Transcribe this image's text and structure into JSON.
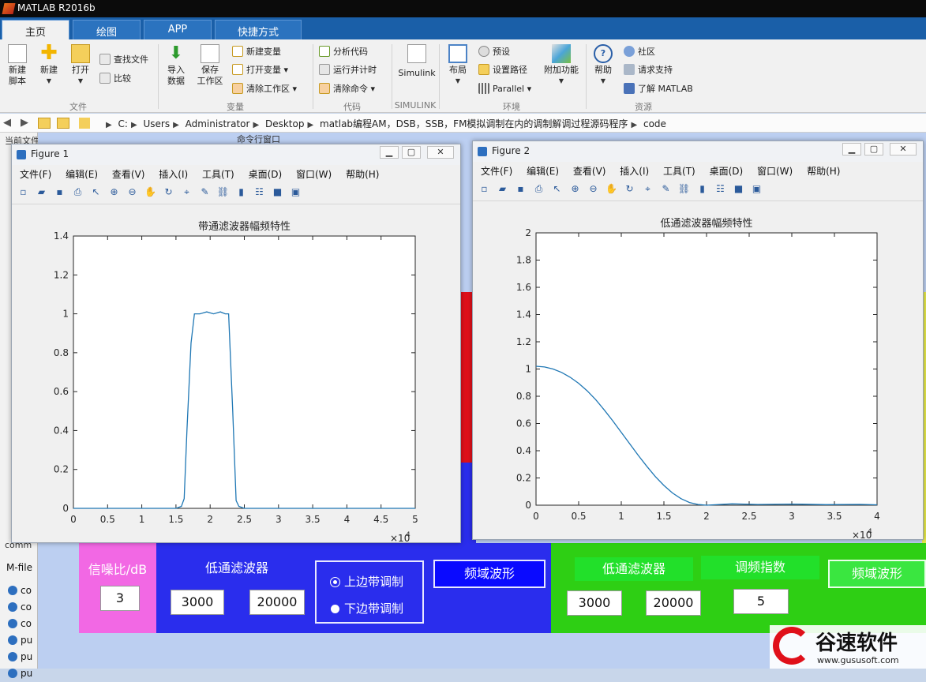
{
  "window": {
    "title": "MATLAB R2016b"
  },
  "tabs": [
    "主页",
    "绘图",
    "APP",
    "快捷方式"
  ],
  "ribbon": {
    "file": {
      "new_script": "新建\n脚本",
      "new": "新建",
      "open": "打开",
      "find_files": "查找文件",
      "compare": "比较",
      "group": "文件"
    },
    "variable": {
      "import": "导入\n数据",
      "save": "保存\n工作区",
      "new_var": "新建变量",
      "open_var": "打开变量",
      "clear_ws": "清除工作区",
      "group": "变量"
    },
    "code": {
      "analyze": "分析代码",
      "run_time": "运行并计时",
      "clear_cmd": "清除命令",
      "group": "代码"
    },
    "simulink": {
      "label": "Simulink",
      "group": "SIMULINK"
    },
    "env": {
      "layout": "布局",
      "prefs": "预设",
      "set_path": "设置路径",
      "parallel": "Parallel",
      "addons": "附加功能",
      "group": "环境"
    },
    "resources": {
      "help": "帮助",
      "community": "社区",
      "support": "请求支持",
      "learn": "了解 MATLAB",
      "group": "资源"
    }
  },
  "address": {
    "path": [
      "C:",
      "Users",
      "Administrator",
      "Desktop",
      "matlab编程AM，DSB，SSB，FM模拟调制在内的调制解调过程源码程序",
      "code"
    ]
  },
  "left_panel": {
    "current_folder": "当前文件夹",
    "cmd_window": "命令行窗口",
    "comm": "comm",
    "mfile": "M-file",
    "files": [
      "co",
      "co",
      "co",
      "pu",
      "pu",
      "pu"
    ]
  },
  "figure1": {
    "title": "Figure 1",
    "menu": [
      "文件(F)",
      "编辑(E)",
      "查看(V)",
      "插入(I)",
      "工具(T)",
      "桌面(D)",
      "窗口(W)",
      "帮助(H)"
    ]
  },
  "figure2": {
    "title": "Figure 2",
    "menu": [
      "文件(F)",
      "编辑(E)",
      "查看(V)",
      "插入(I)",
      "工具(T)",
      "桌面(D)",
      "窗口(W)",
      "帮助(H)"
    ]
  },
  "chart_data": [
    {
      "type": "line",
      "title": "带通滤波器幅频特性",
      "xlabel": "",
      "ylabel": "",
      "x_exponent": "×10",
      "x_exponent_power": "4",
      "xlim": [
        0,
        5
      ],
      "ylim": [
        0,
        1.4
      ],
      "xticks": [
        "0",
        "0.5",
        "1",
        "1.5",
        "2",
        "2.5",
        "3",
        "3.5",
        "4",
        "4.5",
        "5"
      ],
      "yticks": [
        "0",
        "0.2",
        "0.4",
        "0.6",
        "0.8",
        "1",
        "1.2",
        "1.4"
      ],
      "series": [
        {
          "color": "#1f77b4",
          "x": [
            0,
            1.5,
            1.58,
            1.62,
            1.66,
            1.72,
            1.77,
            1.85,
            1.95,
            2.05,
            2.15,
            2.22,
            2.27,
            2.33,
            2.38,
            2.42,
            2.5,
            5
          ],
          "y": [
            0,
            0,
            0.01,
            0.05,
            0.4,
            0.85,
            1.0,
            1.0,
            1.01,
            1.0,
            1.01,
            1.0,
            1.0,
            0.5,
            0.04,
            0.01,
            0,
            0
          ]
        }
      ]
    },
    {
      "type": "line",
      "title": "低通滤波器幅频特性",
      "xlabel": "",
      "ylabel": "",
      "x_exponent": "×10",
      "x_exponent_power": "4",
      "xlim": [
        0,
        4
      ],
      "ylim": [
        0,
        2
      ],
      "xticks": [
        "0",
        "0.5",
        "1",
        "1.5",
        "2",
        "2.5",
        "3",
        "3.5",
        "4"
      ],
      "yticks": [
        "0",
        "0.2",
        "0.4",
        "0.6",
        "0.8",
        "1",
        "1.2",
        "1.4",
        "1.6",
        "1.8",
        "2"
      ],
      "series": [
        {
          "color": "#1f77b4",
          "x": [
            0,
            0.1,
            0.2,
            0.3,
            0.4,
            0.5,
            0.6,
            0.7,
            0.8,
            0.9,
            1.0,
            1.1,
            1.2,
            1.3,
            1.4,
            1.5,
            1.6,
            1.7,
            1.8,
            1.9,
            2.0,
            2.3,
            2.6,
            3.0,
            3.4,
            3.8,
            4.0
          ],
          "y": [
            1.02,
            1.015,
            1.0,
            0.975,
            0.94,
            0.895,
            0.84,
            0.775,
            0.7,
            0.62,
            0.535,
            0.45,
            0.365,
            0.285,
            0.21,
            0.145,
            0.09,
            0.048,
            0.02,
            0.005,
            0.0,
            0.01,
            0.005,
            0.008,
            0.004,
            0.006,
            0.003
          ]
        }
      ]
    }
  ],
  "gui": {
    "snr_label": "信噪比/dB",
    "snr_value": "3",
    "lpf_label": "低通滤波器",
    "lpf_low": "3000",
    "lpf_high": "20000",
    "usb_label": "上边带调制",
    "lsb_label": "下边带调制",
    "freq_wave": "频域波形",
    "fm_lpf_label": "低通滤波器",
    "fm_index_label": "调频指数",
    "fm_lpf_low": "3000",
    "fm_lpf_high": "20000",
    "fm_index": "5",
    "fm_freq_wave": "频域波形"
  },
  "watermark": {
    "brand": "谷速软件",
    "url": "www.gususoft.com"
  },
  "colors": {
    "ribbon_tab": "#1a5fa8",
    "gui_pink": "#f268e4",
    "gui_blue": "#2a2ded",
    "gui_green": "#2ecf14",
    "gui_red": "#e0101a"
  }
}
